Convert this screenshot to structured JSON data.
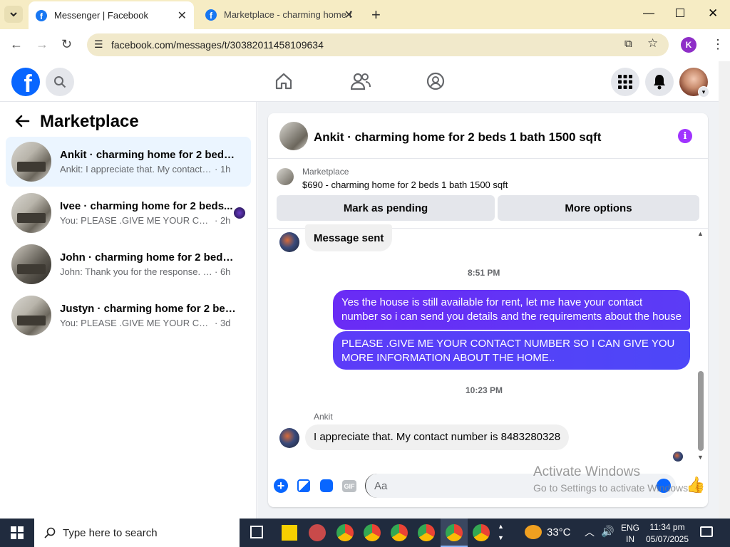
{
  "browser": {
    "tabs": [
      {
        "title": "Messenger | Facebook"
      },
      {
        "title": "Marketplace - charming home f"
      }
    ],
    "url": "facebook.com/messages/t/30382011458109634",
    "profile_initial": "K"
  },
  "fb": {
    "logo": "f"
  },
  "left": {
    "title": "Marketplace",
    "conversations": [
      {
        "title": "Ankit · charming home for 2 beds ...",
        "preview": "Ankit: I appreciate that. My contact n...",
        "time": "· 1h"
      },
      {
        "title": "Ivee · charming home for 2 beds...",
        "preview": "You: PLEASE .GIVE ME YOUR CONT...",
        "time": "· 2h"
      },
      {
        "title": "John · charming home for 2 beds 1...",
        "preview": "John: Thank you for the response. Joh...",
        "time": "· 6h"
      },
      {
        "title": "Justyn · charming home for 2 beds...",
        "preview": "You: PLEASE .GIVE ME YOUR CONTAC...",
        "time": "· 3d"
      }
    ]
  },
  "chat": {
    "title": "Ankit · charming home for 2 beds 1 bath 1500 sqft",
    "listing_label": "Marketplace",
    "listing_desc": "$690 - charming home for 2 beds 1 bath 1500 sqft",
    "mark_pending": "Mark as pending",
    "more_options": "More options",
    "message_sent": "Message sent",
    "time1": "8:51 PM",
    "out1": "Yes the house is still available for rent, let me have your contact number so i can send you details and the requirements about the house",
    "out2": "PLEASE .GIVE ME YOUR CONTACT NUMBER SO I CAN GIVE YOU MORE INFORMATION ABOUT THE HOME..",
    "time2": "10:23 PM",
    "sender": "Ankit",
    "in1": "I appreciate that. My contact number is 8483280328",
    "input_placeholder": "Aa",
    "gif": "GIF"
  },
  "watermark": {
    "line1": "Activate Windows",
    "line2": "Go to Settings to activate Windows."
  },
  "taskbar": {
    "search_placeholder": "Type here to search",
    "weather": "33°C",
    "lang1": "ENG",
    "lang2": "IN",
    "time": "11:34 pm",
    "date": "05/07/2025"
  },
  "colors": {
    "accent": "#0866ff",
    "bubble_out": "#6a2bf5",
    "purple_info": "#a033ff"
  }
}
